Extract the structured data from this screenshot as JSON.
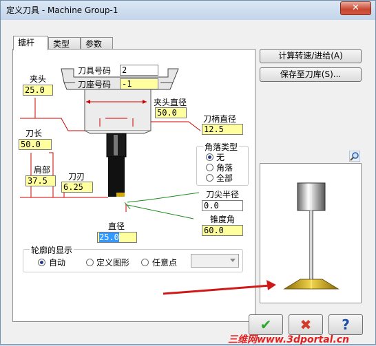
{
  "window": {
    "title": "定义刀具 - Machine Group-1",
    "close_label": "✕"
  },
  "tabs": [
    {
      "label": "搪杆",
      "active": true
    },
    {
      "label": "类型",
      "active": false
    },
    {
      "label": "参数",
      "active": false
    }
  ],
  "tool": {
    "tool_number_label": "刀具号码",
    "tool_number_value": "2",
    "library_number_label": "刀座号码",
    "library_number_value": "-1",
    "chuck_label": "夹头",
    "chuck_value": "25.0",
    "chuck_diameter_label": "夹头直径",
    "chuck_diameter_value": "50.0",
    "shank_diameter_label": "刀柄直径",
    "shank_diameter_value": "12.5",
    "tool_length_label": "刀长",
    "tool_length_value": "50.0",
    "shoulder_label": "肩部",
    "shoulder_value": "37.5",
    "flute_label": "刀刃",
    "flute_value": "6.25",
    "corner_type_label": "角落类型",
    "corner_options": [
      {
        "label": "无",
        "selected": true
      },
      {
        "label": "角落",
        "selected": false
      },
      {
        "label": "全部",
        "selected": false
      }
    ],
    "tip_radius_label": "刀尖半径",
    "tip_radius_value": "0.0",
    "taper_label": "锥度角",
    "taper_value": "60.0",
    "diameter_label": "直径",
    "diameter_value": "25.0"
  },
  "profile": {
    "title": "轮廓的显示",
    "options": [
      {
        "label": "自动",
        "selected": true
      },
      {
        "label": "定义图形",
        "selected": false
      },
      {
        "label": "任意点",
        "selected": false
      }
    ],
    "combo_value": ""
  },
  "side_buttons": {
    "calc_speed": "计算转速/进给(A)",
    "save_library": "保存至刀库(S)..."
  },
  "bottom_buttons": {
    "ok": "✔",
    "cancel": "✖",
    "help": "?"
  },
  "watermark": "三维网www.3dportal.cn",
  "colors": {
    "field_yellow": "#ffffa0",
    "ok_green": "#2ea82e",
    "cancel_red": "#d23a2a",
    "help_blue": "#1a4fa8",
    "gold": "#c89a10"
  }
}
